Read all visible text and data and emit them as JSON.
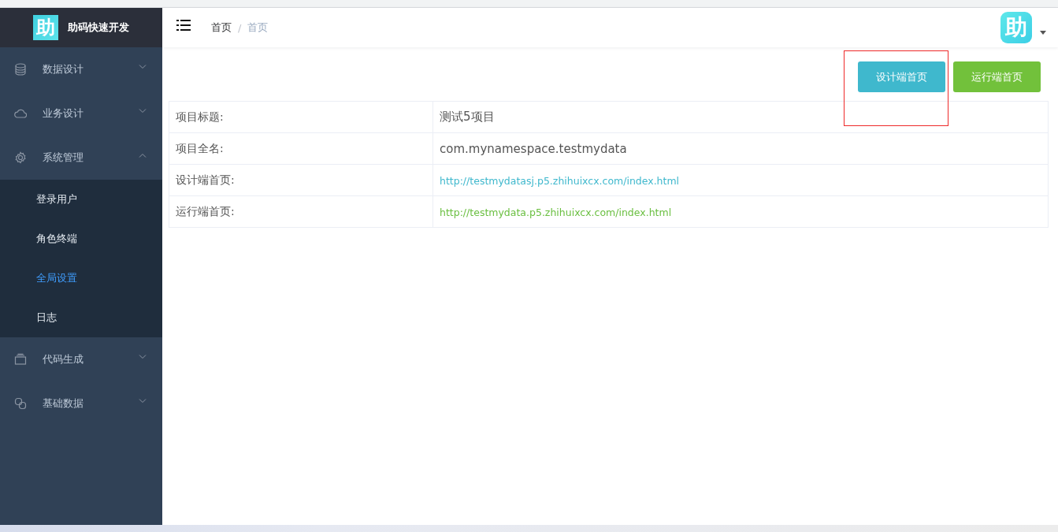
{
  "sidebar": {
    "logo": {
      "mark": "助",
      "title": "助码快速开发"
    },
    "items": [
      {
        "label": "数据设计",
        "expanded": false
      },
      {
        "label": "业务设计",
        "expanded": false
      },
      {
        "label": "系统管理",
        "expanded": true,
        "children": [
          {
            "label": "登录用户",
            "selected": false
          },
          {
            "label": "角色终端",
            "selected": false
          },
          {
            "label": "全局设置",
            "selected": true
          },
          {
            "label": "日志",
            "selected": false
          }
        ]
      },
      {
        "label": "代码生成",
        "expanded": false
      },
      {
        "label": "基础数据",
        "expanded": false
      }
    ]
  },
  "header": {
    "breadcrumb": [
      "首页",
      "首页"
    ],
    "breadcrumb_separator": "/",
    "avatar": "助"
  },
  "buttons": [
    {
      "label": "设计端首页",
      "kind": "design",
      "highlighted": true
    },
    {
      "label": "运行端首页",
      "kind": "run",
      "highlighted": false
    }
  ],
  "table": {
    "rows": [
      {
        "label": "项目标题:",
        "value": "测试5项目",
        "kind": "text"
      },
      {
        "label": "项目全名:",
        "value": "com.mynamespace.testmydata",
        "kind": "text"
      },
      {
        "label": "设计端首页:",
        "value": "http://testmydatasj.p5.zhihuixcx.com/index.html",
        "kind": "design-link"
      },
      {
        "label": "运行端首页:",
        "value": "http://testmydata.p5.zhihuixcx.com/index.html",
        "kind": "run-link"
      }
    ]
  }
}
